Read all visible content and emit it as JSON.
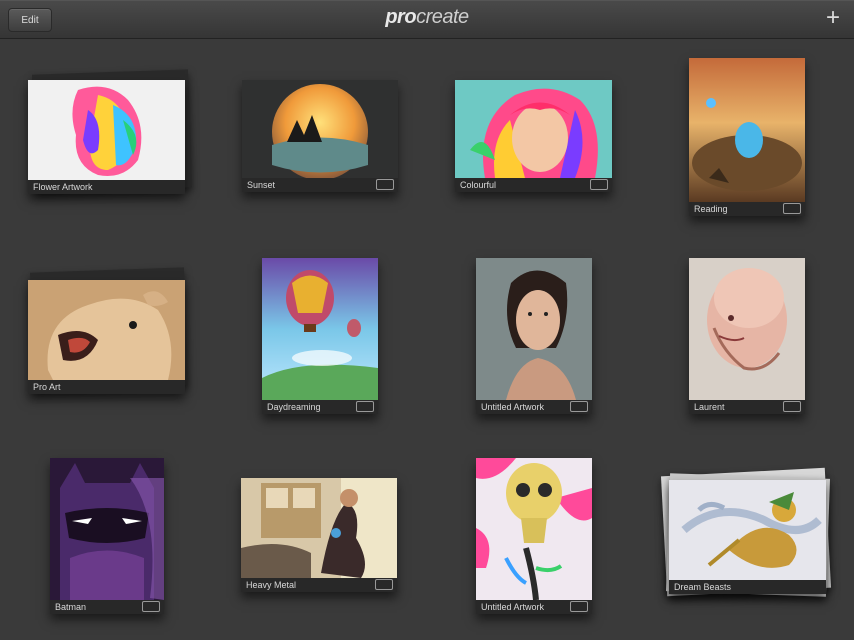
{
  "app": {
    "edit_label": "Edit",
    "logo_pro": "pro",
    "logo_create": "create",
    "add_glyph": "+",
    "add_icon": "plus-icon"
  },
  "gallery": [
    {
      "title": "Flower Artwork",
      "badge": "",
      "stack": true
    },
    {
      "title": "Sunset",
      "badge": "",
      "stack": false
    },
    {
      "title": "Colourful",
      "badge": "",
      "stack": false
    },
    {
      "title": "Reading",
      "badge": "",
      "stack": false
    },
    {
      "title": "Pro Art",
      "badge": "",
      "stack": true
    },
    {
      "title": "Daydreaming",
      "badge": "",
      "stack": false
    },
    {
      "title": "Untitled Artwork",
      "badge": "",
      "stack": false
    },
    {
      "title": "Laurent",
      "badge": "",
      "stack": false
    },
    {
      "title": "Batman",
      "badge": "",
      "stack": false
    },
    {
      "title": "Heavy Metal",
      "badge": "",
      "stack": false
    },
    {
      "title": "Untitled Artwork",
      "badge": "",
      "stack": false
    },
    {
      "title": "Dream Beasts",
      "badge": "",
      "stack": true
    }
  ]
}
